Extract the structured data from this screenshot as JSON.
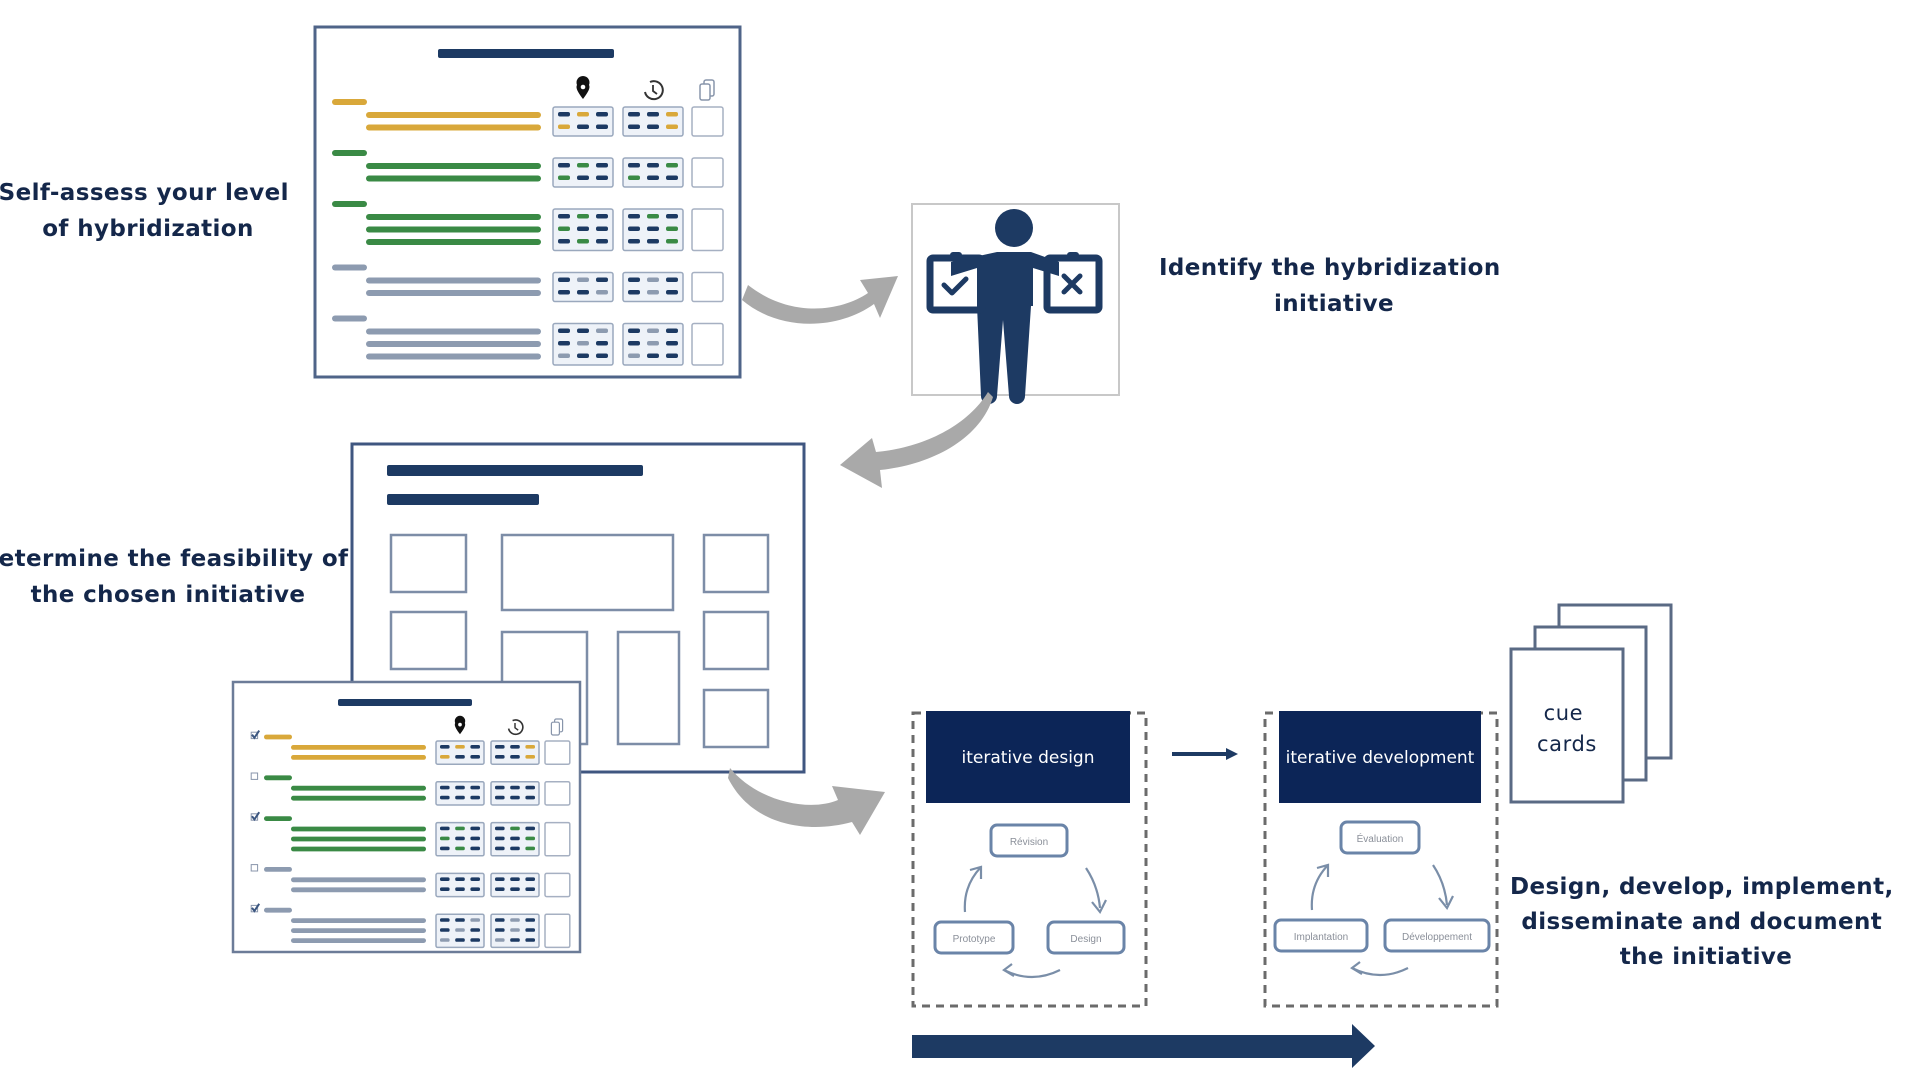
{
  "colors": {
    "navy": "#1d3a63",
    "navy_box": "#0c2557",
    "text": "#14274a",
    "gold": "#d9a83a",
    "green": "#3a8a45",
    "slate": "#8d9bb0",
    "arrow_gray": "#a9a9a9",
    "frame": "#4f6488"
  },
  "steps": {
    "self_assess": {
      "lines": [
        "Self-assess your level",
        "of hybridization"
      ]
    },
    "identify": {
      "lines": [
        "Identify the hybridization",
        "initiative"
      ]
    },
    "feasibility": {
      "lines": [
        "Determine the feasibility of",
        "the chosen initiative"
      ]
    },
    "implement": {
      "lines": [
        "Design, develop, implement,",
        "disseminate and document",
        "the initiative"
      ]
    }
  },
  "assessment_form": {
    "column_icons": [
      "location-pin-icon",
      "time-cycle-icon",
      "document-stack-icon"
    ],
    "groups": [
      {
        "color": "gold",
        "lines": 2,
        "highlight_a": [
          [
            0,
            1,
            0
          ],
          [
            1,
            0,
            0
          ]
        ],
        "highlight_b": [
          [
            0,
            0,
            1
          ],
          [
            0,
            0,
            1
          ]
        ]
      },
      {
        "color": "green",
        "lines": 2,
        "highlight_a": [
          [
            0,
            1,
            0
          ],
          [
            1,
            0,
            0
          ]
        ],
        "highlight_b": [
          [
            0,
            0,
            1
          ],
          [
            1,
            0,
            0
          ]
        ]
      },
      {
        "color": "green",
        "lines": 3,
        "highlight_a": [
          [
            0,
            1,
            0
          ],
          [
            1,
            0,
            0
          ],
          [
            0,
            1,
            0
          ]
        ],
        "highlight_b": [
          [
            0,
            1,
            0
          ],
          [
            0,
            0,
            1
          ],
          [
            0,
            0,
            1
          ]
        ]
      },
      {
        "color": "slate",
        "lines": 2,
        "highlight_a": [
          [
            0,
            1,
            0
          ],
          [
            0,
            0,
            1
          ]
        ],
        "highlight_b": [
          [
            0,
            1,
            0
          ],
          [
            0,
            1,
            0
          ]
        ]
      },
      {
        "color": "slate",
        "lines": 3,
        "highlight_a": [
          [
            0,
            0,
            1
          ],
          [
            0,
            1,
            0
          ],
          [
            1,
            0,
            0
          ]
        ],
        "highlight_b": [
          [
            0,
            1,
            0
          ],
          [
            0,
            1,
            0
          ],
          [
            1,
            0,
            0
          ]
        ]
      }
    ]
  },
  "selection_form": {
    "checked": [
      true,
      false,
      true,
      false,
      true
    ],
    "groups": [
      {
        "color": "gold",
        "lines": 2,
        "highlight_a": [
          [
            0,
            1,
            0
          ],
          [
            1,
            0,
            0
          ]
        ],
        "highlight_b": [
          [
            0,
            0,
            1
          ],
          [
            0,
            0,
            1
          ]
        ]
      },
      {
        "color": "green",
        "lines": 2,
        "highlight_a": [
          [
            0,
            0,
            0
          ],
          [
            0,
            0,
            0
          ]
        ],
        "highlight_b": [
          [
            0,
            0,
            0
          ],
          [
            0,
            0,
            0
          ]
        ]
      },
      {
        "color": "green",
        "lines": 3,
        "highlight_a": [
          [
            0,
            1,
            0
          ],
          [
            1,
            0,
            0
          ],
          [
            0,
            1,
            0
          ]
        ],
        "highlight_b": [
          [
            0,
            1,
            0
          ],
          [
            0,
            0,
            1
          ],
          [
            0,
            0,
            1
          ]
        ]
      },
      {
        "color": "slate",
        "lines": 2,
        "highlight_a": [
          [
            0,
            0,
            0
          ],
          [
            0,
            0,
            0
          ]
        ],
        "highlight_b": [
          [
            0,
            0,
            0
          ],
          [
            0,
            0,
            0
          ]
        ]
      },
      {
        "color": "slate",
        "lines": 3,
        "highlight_a": [
          [
            0,
            0,
            1
          ],
          [
            0,
            1,
            0
          ],
          [
            1,
            0,
            0
          ]
        ],
        "highlight_b": [
          [
            0,
            1,
            0
          ],
          [
            0,
            1,
            0
          ],
          [
            1,
            0,
            0
          ]
        ]
      }
    ]
  },
  "phases": [
    {
      "title": "iterative design",
      "cycle": [
        "Révision",
        "Design",
        "Prototype"
      ]
    },
    {
      "title": "iterative development",
      "cycle": [
        "Évaluation",
        "Développement",
        "Implantation"
      ]
    }
  ],
  "cue_cards": {
    "lines": [
      "cue",
      "cards"
    ]
  }
}
